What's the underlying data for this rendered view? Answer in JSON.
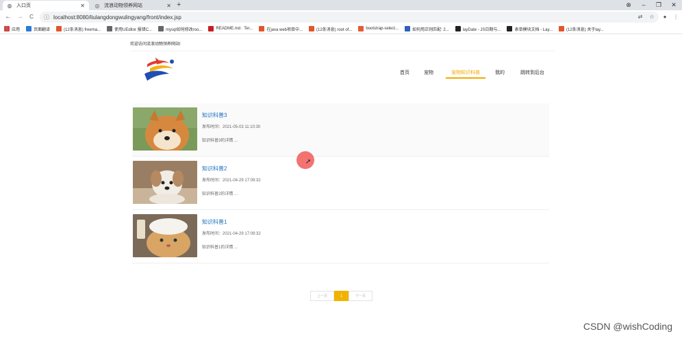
{
  "browser": {
    "tabs": [
      {
        "title": "入口页",
        "active": true
      },
      {
        "title": "流浪动物领养网站",
        "active": false
      }
    ],
    "new_tab": "+",
    "window_controls": [
      "⊗",
      "–",
      "❐",
      "✕"
    ],
    "nav": {
      "back": "←",
      "forward": "→",
      "reload": "C"
    },
    "url": "localhost:8080/liulangdongwulingyang/front/index.jsp",
    "bookmarks": [
      {
        "label": "应用",
        "icon": "apps-icon",
        "color": "#c44"
      },
      {
        "label": "页面翻译",
        "icon": "translate-icon",
        "color": "#2d7bd8"
      },
      {
        "label": "(12条消息) freema...",
        "icon": "csdn-icon",
        "color": "#e2552c"
      },
      {
        "label": "使用UEditor 报错C...",
        "icon": "lock-bookmark-icon",
        "color": "#666"
      },
      {
        "label": "mysql如何修改roo...",
        "icon": "lock-bookmark-icon",
        "color": "#666"
      },
      {
        "label": "README.md · Ter...",
        "icon": "gitee-icon",
        "color": "#c71d23"
      },
      {
        "label": "在java web项目中...",
        "icon": "csdn-icon",
        "color": "#e2552c"
      },
      {
        "label": "(12条消息) root of...",
        "icon": "csdn-icon",
        "color": "#e2552c"
      },
      {
        "label": "bootstrap-select...",
        "icon": "orange-page-icon",
        "color": "#e55a36"
      },
      {
        "label": "如何用正则匹配: 2...",
        "icon": "zhidao-icon",
        "color": "#3060c0"
      },
      {
        "label": "layDate - JS日期与...",
        "icon": "layui-icon",
        "color": "#222"
      },
      {
        "label": "表单模块文档 - Lay...",
        "icon": "layui-icon",
        "color": "#222"
      },
      {
        "label": "(12条消息) 关于lay...",
        "icon": "csdn-icon",
        "color": "#e2552c"
      }
    ]
  },
  "page": {
    "welcome": "欢迎访问流浪动物领养网站!",
    "nav": [
      {
        "label": "首页",
        "active": false
      },
      {
        "label": "宠物",
        "active": false
      },
      {
        "label": "宠物知识科普",
        "active": true
      },
      {
        "label": "我的",
        "active": false
      },
      {
        "label": "跳转到后台",
        "active": false
      }
    ],
    "articles": [
      {
        "title": "知识科普3",
        "date": "发布时间：2021-05-03 11:10:30",
        "desc": "知识科普3的详情 ...",
        "image": "shiba-dog"
      },
      {
        "title": "知识科普2",
        "date": "发布时间：2021-04-29 17:09:32",
        "desc": "知识科普2的详情 ...",
        "image": "puppy"
      },
      {
        "title": "知识科普1",
        "date": "发布时间：2021-04-29 17:09:32",
        "desc": "知识科普1的详情 ...",
        "image": "cat"
      }
    ],
    "pagination": {
      "prev": "上一页",
      "current": "1",
      "next": "下一页"
    }
  },
  "watermark": "CSDN @wishCoding",
  "colors": {
    "accent": "#f0a800",
    "link": "#1b6fbd"
  }
}
